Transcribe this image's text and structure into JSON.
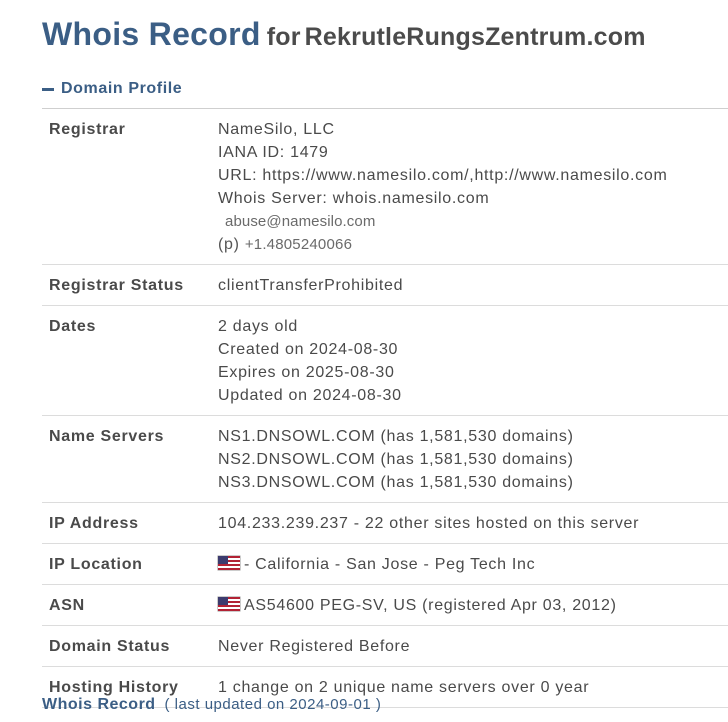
{
  "title": {
    "main": "Whois Record",
    "for": "for",
    "domain": "RekrutleRungsZentrum.com"
  },
  "profile": {
    "heading": "Domain Profile"
  },
  "registrar": {
    "label": "Registrar",
    "name": "NameSilo, LLC",
    "iana": "IANA ID: 1479",
    "url": "URL: https://www.namesilo.com/,http://www.namesilo.com",
    "whois_server": "Whois Server: whois.namesilo.com",
    "email": "abuse@namesilo.com",
    "phone_prefix": "(p)",
    "phone": "+1.4805240066"
  },
  "registrar_status": {
    "label": "Registrar Status",
    "value": "clientTransferProhibited"
  },
  "dates": {
    "label": "Dates",
    "age": "2 days old",
    "created": "Created on 2024-08-30",
    "expires": "Expires on 2025-08-30",
    "updated": "Updated on 2024-08-30"
  },
  "name_servers": {
    "label": "Name Servers",
    "items": [
      "NS1.DNSOWL.COM (has 1,581,530 domains)",
      "NS2.DNSOWL.COM (has 1,581,530 domains)",
      "NS3.DNSOWL.COM (has 1,581,530 domains)"
    ]
  },
  "ip_address": {
    "label": "IP Address",
    "value": "104.233.239.237 - 22 other sites hosted on this server"
  },
  "ip_location": {
    "label": "IP Location",
    "value": "- California - San Jose - Peg Tech Inc",
    "flag": "us-flag-icon"
  },
  "asn": {
    "label": "ASN",
    "value": "AS54600 PEG-SV, US (registered Apr 03, 2012)",
    "flag": "us-flag-icon"
  },
  "domain_status": {
    "label": "Domain Status",
    "value": "Never Registered Before"
  },
  "hosting_history": {
    "label": "Hosting History",
    "value": "1 change on 2 unique name servers over 0 year"
  },
  "footer": {
    "label": "Whois Record",
    "updated": "( last updated on 2024-09-01 )"
  },
  "colors": {
    "accent": "#3b5e85",
    "text": "#4a4a4a",
    "divider": "#dcdcdc"
  }
}
